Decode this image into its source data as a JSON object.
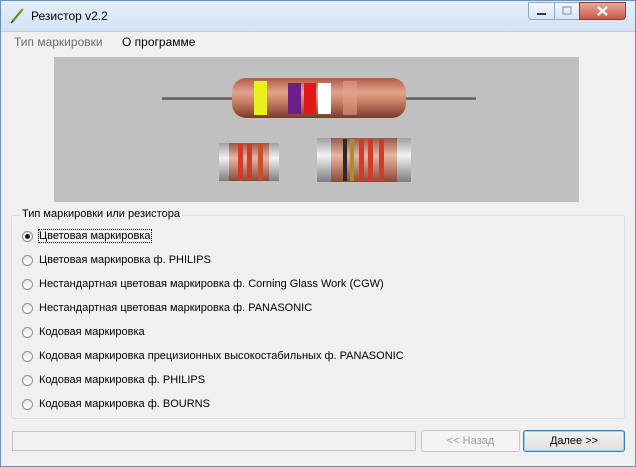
{
  "window": {
    "title": "Резистор v2.2"
  },
  "menu": {
    "items": [
      "Тип маркировки",
      "О программе"
    ]
  },
  "options_group": {
    "title": "Тип маркировки или резистора",
    "selected_index": 0,
    "options": [
      "Цветовая маркировка",
      "Цветовая маркировка ф. PHILIPS",
      "Нестандартная цветовая маркировка ф. Corning Glass Work (CGW)",
      "Нестандартная цветовая маркировка ф. PANASONIC",
      "Кодовая маркировка",
      "Кодовая маркировка прецизионных высокостабильных ф. PANASONIC",
      "Кодовая маркировка ф. PHILIPS",
      "Кодовая маркировка ф. BOURNS"
    ]
  },
  "buttons": {
    "back_label": "<< Назад",
    "next_label": "Далее >>"
  },
  "colors": {
    "resistor_body": "#c97e64",
    "band_yellow": "#e8f020",
    "band_violet": "#6a1f8a",
    "band_red": "#e01818",
    "band_white": "#ffffff",
    "panel_background": "#c0c0c0"
  },
  "icons": {
    "app": "resistor-pen-icon",
    "minimize": "minimize-icon",
    "maximize": "maximize-icon",
    "close": "close-icon"
  }
}
